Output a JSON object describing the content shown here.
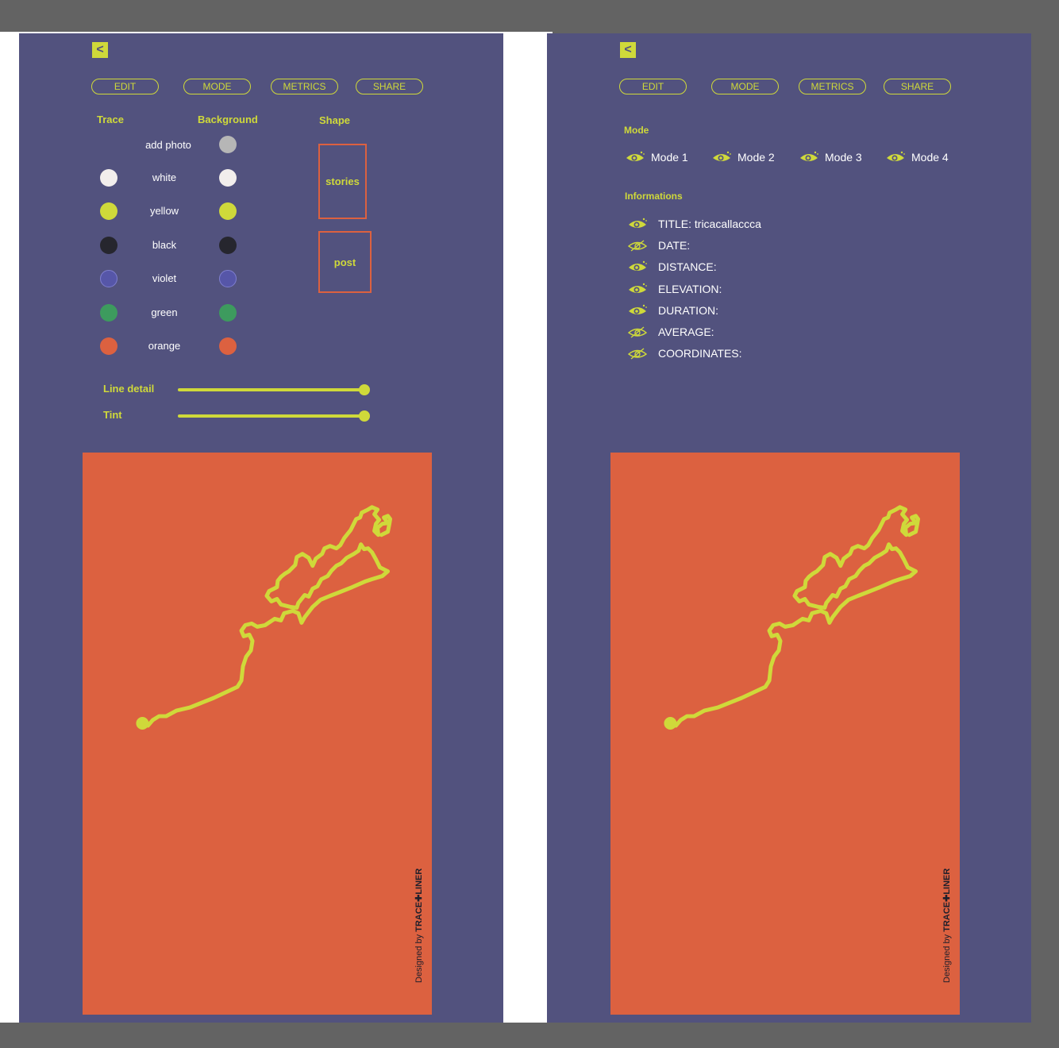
{
  "colors": {
    "panel": "#52527e",
    "accent": "#cfd93a",
    "poster_bg": "#dc6140",
    "canvas": "#636363"
  },
  "left_screen": {
    "back_label": "<",
    "nav": {
      "edit": "EDIT",
      "mode": "MODE",
      "metrics": "METRICS",
      "share": "SHARE"
    },
    "headers": {
      "trace": "Trace",
      "background": "Background",
      "shape": "Shape"
    },
    "add_photo": "add photo",
    "colors": [
      {
        "name": "white",
        "hex": "#f2eeec"
      },
      {
        "name": "yellow",
        "hex": "#cfd93a"
      },
      {
        "name": "black",
        "hex": "#26262e"
      },
      {
        "name": "violet",
        "hex": "#5656a8"
      },
      {
        "name": "green",
        "hex": "#3d9b5e"
      },
      {
        "name": "orange",
        "hex": "#dc6140"
      }
    ],
    "shapes": {
      "stories": "stories",
      "post": "post"
    },
    "sliders": {
      "line_detail": "Line detail",
      "line_detail_value": 1.0,
      "tint": "Tint",
      "tint_value": 1.0
    },
    "poster": {
      "credit_prefix": "Designed by ",
      "credit_brand": "TRACE✚LINER"
    }
  },
  "right_screen": {
    "back_label": "<",
    "nav": {
      "edit": "EDIT",
      "mode": "MODE",
      "metrics": "METRICS",
      "share": "SHARE"
    },
    "mode_header": "Mode",
    "modes": [
      "Mode 1",
      "Mode 2",
      "Mode 3",
      "Mode 4"
    ],
    "info_header": "Informations",
    "info_items": [
      {
        "label": "TITLE: tricacallaccca",
        "visible": true
      },
      {
        "label": "DATE:",
        "visible": false
      },
      {
        "label": "DISTANCE:",
        "visible": true
      },
      {
        "label": "ELEVATION:",
        "visible": true
      },
      {
        "label": "DURATION:",
        "visible": true
      },
      {
        "label": "AVERAGE:",
        "visible": false
      },
      {
        "label": "COORDINATES:",
        "visible": false
      }
    ],
    "poster": {
      "credit_prefix": "Designed by ",
      "credit_brand": "TRACE✚LINER"
    }
  }
}
